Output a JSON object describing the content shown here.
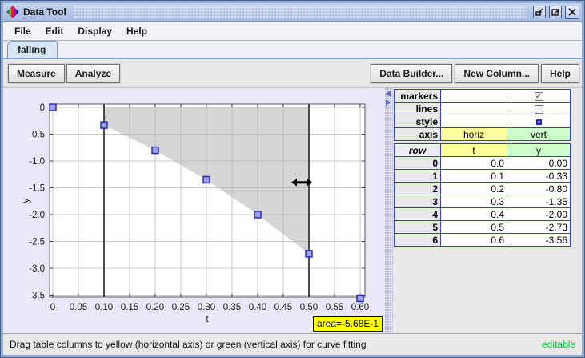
{
  "window": {
    "title": "Data Tool"
  },
  "menu": {
    "items": [
      "File",
      "Edit",
      "Display",
      "Help"
    ]
  },
  "tabs": {
    "selected": "falling"
  },
  "toolbar": {
    "left": [
      "Measure",
      "Analyze"
    ],
    "right": [
      "Data Builder...",
      "New Column...",
      "Help"
    ]
  },
  "table": {
    "properties": [
      {
        "label": "markers",
        "t": {
          "type": "empty"
        },
        "y": {
          "type": "checkbox",
          "checked": true
        }
      },
      {
        "label": "lines",
        "t": {
          "type": "empty"
        },
        "y": {
          "type": "checkbox",
          "checked": false
        }
      },
      {
        "label": "style",
        "t": {
          "type": "empty"
        },
        "y": {
          "type": "marker"
        }
      },
      {
        "label": "axis",
        "t": {
          "type": "text",
          "value": "horiz",
          "bg": "yellow"
        },
        "y": {
          "type": "text",
          "value": "vert",
          "bg": "green"
        }
      }
    ],
    "columns": [
      "row",
      "t",
      "y"
    ],
    "rows": [
      [
        "0",
        "0.0",
        "0.00"
      ],
      [
        "1",
        "0.1",
        "-0.33"
      ],
      [
        "2",
        "0.2",
        "-0.80"
      ],
      [
        "3",
        "0.3",
        "-1.35"
      ],
      [
        "4",
        "0.4",
        "-2.00"
      ],
      [
        "5",
        "0.5",
        "-2.73"
      ],
      [
        "6",
        "0.6",
        "-3.56"
      ]
    ]
  },
  "statusbar": {
    "hint": "Drag table columns to yellow (horizontal axis) or green (vertical axis) for curve fitting",
    "mode": "editable"
  },
  "colors": {
    "horizontal_axis": "#ffff99",
    "vertical_axis": "#ccffcc",
    "area_label_bg": "#ffff00",
    "marker_fill": "#98a0e8",
    "marker_stroke": "#2a2ab8",
    "editable_text": "#00cc33"
  },
  "chart_data": {
    "type": "scatter",
    "xlabel": "t",
    "ylabel": "y",
    "x": [
      0.0,
      0.1,
      0.2,
      0.3,
      0.4,
      0.5,
      0.6
    ],
    "series": [
      {
        "name": "y",
        "values": [
          0.0,
          -0.33,
          -0.8,
          -1.35,
          -2.0,
          -2.73,
          -3.56
        ]
      }
    ],
    "xtick_values": [
      0,
      0.05,
      0.1,
      0.15,
      0.2,
      0.25,
      0.3,
      0.35,
      0.4,
      0.45,
      0.5,
      0.55,
      0.6
    ],
    "xtick_labels": [
      "0",
      "0.05",
      "0.10",
      "0.15",
      "0.20",
      "0.25",
      "0.30",
      "0.35",
      "0.40",
      "0.45",
      "0.50",
      "0.55",
      "0.60"
    ],
    "ytick_values": [
      0,
      -0.5,
      -1.0,
      -1.5,
      -2.0,
      -2.5,
      -3.0,
      -3.5
    ],
    "ytick_labels": [
      "0",
      "-0.5",
      "-1.0",
      "-1.5",
      "-2.0",
      "-2.5",
      "-3.0",
      "-3.5"
    ],
    "xlim": [
      -0.006,
      0.61
    ],
    "ylim": [
      -3.7,
      0.06
    ],
    "grid": true,
    "legend": "none",
    "limit_lines": {
      "x": [
        0.1,
        0.5
      ]
    },
    "shaded_region": {
      "x_from": 0.1,
      "x_to": 0.5,
      "upper_bound": "y=0",
      "lower_bound": "data curve"
    },
    "area_label": "area=-5.68E-1",
    "marker": {
      "shape": "square",
      "size": 8
    }
  }
}
